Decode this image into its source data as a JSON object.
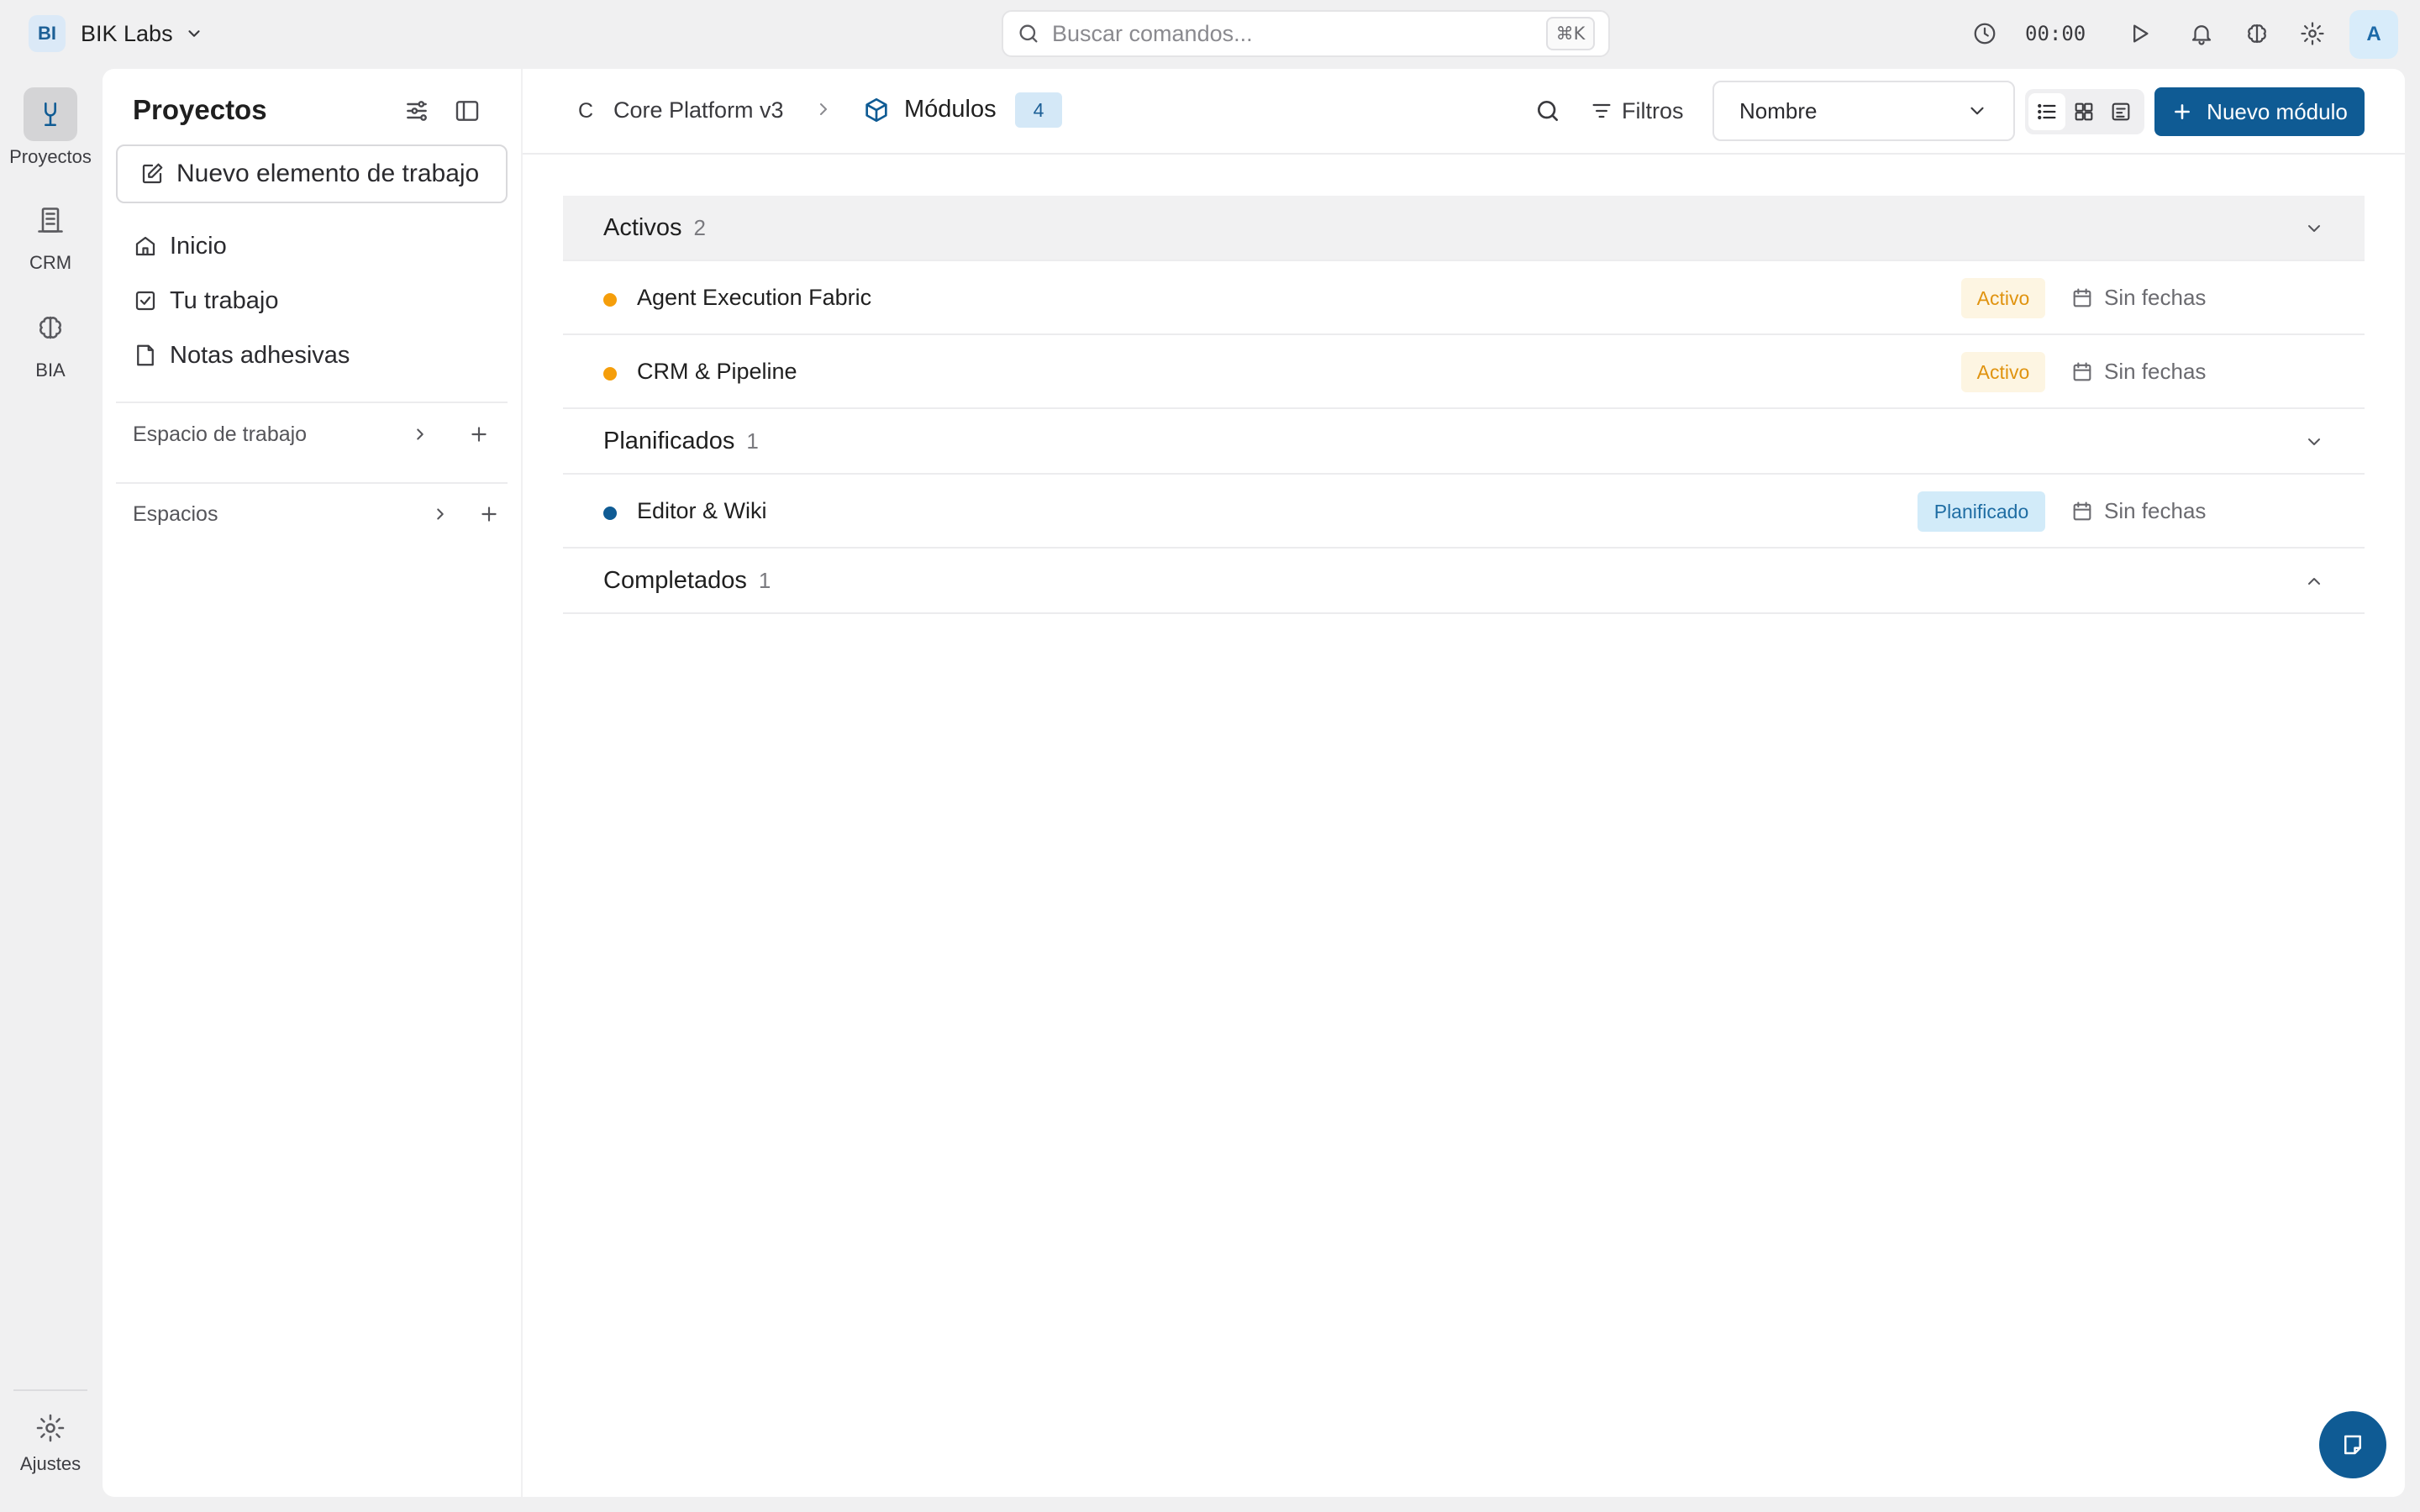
{
  "workspace": {
    "badge": "BI",
    "name": "BIK Labs"
  },
  "command_search": {
    "placeholder": "Buscar comandos...",
    "shortcut": "⌘K"
  },
  "topbar": {
    "timer": "00:00",
    "avatar": "A"
  },
  "rail": {
    "items": [
      {
        "label": "Proyectos",
        "icon": "projects-icon"
      },
      {
        "label": "CRM",
        "icon": "crm-icon"
      },
      {
        "label": "BIA",
        "icon": "brain-icon"
      }
    ],
    "settings_label": "Ajustes"
  },
  "sidebar": {
    "title": "Proyectos",
    "new_item_label": "Nuevo elemento de trabajo",
    "nav": [
      {
        "label": "Inicio",
        "icon": "home-icon"
      },
      {
        "label": "Tu trabajo",
        "icon": "checkbox-icon"
      },
      {
        "label": "Notas adhesivas",
        "icon": "note-icon"
      }
    ],
    "sections": [
      {
        "label": "Espacio de trabajo"
      },
      {
        "label": "Espacios"
      }
    ]
  },
  "main": {
    "breadcrumb": {
      "project_initial": "C",
      "project": "Core Platform v3",
      "current": "Módulos",
      "count": "4"
    },
    "filters_label": "Filtros",
    "sort_value": "Nombre",
    "new_module_label": "Nuevo módulo",
    "groups": [
      {
        "name": "Activos",
        "count": "2",
        "collapsed": false,
        "rows": [
          {
            "name": "Agent Execution Fabric",
            "status": "Activo",
            "dates": "Sin fechas",
            "dot_color": "#f59e0b"
          },
          {
            "name": "CRM & Pipeline",
            "status": "Activo",
            "dates": "Sin fechas",
            "dot_color": "#f59e0b"
          }
        ]
      },
      {
        "name": "Planificados",
        "count": "1",
        "collapsed": false,
        "rows": [
          {
            "name": "Editor & Wiki",
            "status": "Planificado",
            "dates": "Sin fechas",
            "dot_color": "#0f5b94"
          }
        ]
      },
      {
        "name": "Completados",
        "count": "1",
        "collapsed": true,
        "rows": []
      }
    ]
  },
  "colors": {
    "accent": "#0f5b94",
    "active_status": "#e0930f",
    "planned_status": "#1f6da3"
  }
}
